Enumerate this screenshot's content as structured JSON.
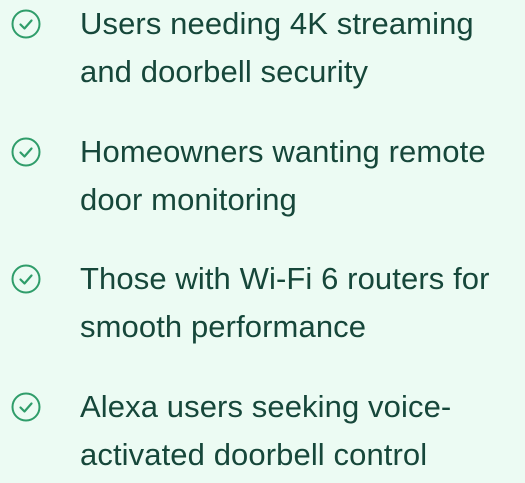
{
  "colors": {
    "background": "#ecfbf3",
    "text": "#16473a",
    "check_accent": "#2f9d6a"
  },
  "feature_list": {
    "items": [
      {
        "icon": "check-circle-icon",
        "line1": "Users needing 4K streaming",
        "line2": "and doorbell security"
      },
      {
        "icon": "check-circle-icon",
        "line1": "Homeowners wanting remote",
        "line2": "door monitoring"
      },
      {
        "icon": "check-circle-icon",
        "line1": "Those with Wi-Fi 6 routers for",
        "line2": "smooth performance"
      },
      {
        "icon": "check-circle-icon",
        "line1": "Alexa users seeking voice-",
        "line2": "activated doorbell control"
      }
    ]
  }
}
